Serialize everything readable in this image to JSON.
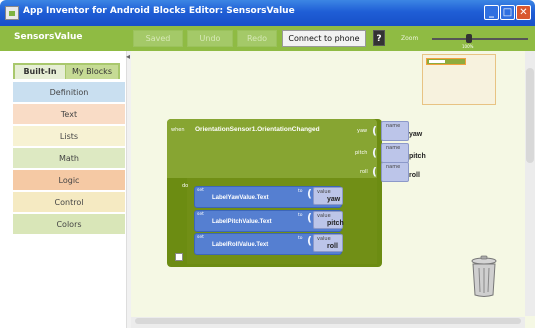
{
  "window": {
    "title": "App Inventor for Android Blocks Editor: SensorsValue",
    "min": "_",
    "max": "□",
    "close": "✕"
  },
  "toolbar": {
    "project_name": "SensorsValue",
    "saved": "Saved",
    "undo": "Undo",
    "redo": "Redo",
    "connect": "Connect to phone",
    "help": "?",
    "zoom_label": "Zoom",
    "zoom_value": "100%",
    "zoom_level_percent": 100
  },
  "sidebar": {
    "tabs": [
      {
        "label": "Built-In"
      },
      {
        "label": "My Blocks"
      }
    ],
    "drawers": [
      {
        "label": "Definition",
        "color": "#c9dff0"
      },
      {
        "label": "Text",
        "color": "#f9dcc6"
      },
      {
        "label": "Lists",
        "color": "#f7f2d3"
      },
      {
        "label": "Math",
        "color": "#dde9c2"
      },
      {
        "label": "Logic",
        "color": "#f5c9a4"
      },
      {
        "label": "Control",
        "color": "#f5eac2"
      },
      {
        "label": "Colors",
        "color": "#d9e6b8"
      }
    ]
  },
  "event_block": {
    "when": "when",
    "name": "OrientationSensor1.OrientationChanged",
    "params": [
      {
        "label": "yaw",
        "name_label": "name",
        "value": "yaw"
      },
      {
        "label": "pitch",
        "name_label": "name",
        "value": "pitch"
      },
      {
        "label": "roll",
        "name_label": "name",
        "value": "roll"
      }
    ],
    "do": "do",
    "statements": [
      {
        "set": "set",
        "property": "LabelYawValue.Text",
        "to": "to",
        "value_label": "value",
        "value": "yaw"
      },
      {
        "set": "set",
        "property": "LabelPitchValue.Text",
        "to": "to",
        "value_label": "value",
        "value": "pitch"
      },
      {
        "set": "set",
        "property": "LabelRollValue.Text",
        "to": "to",
        "value_label": "value",
        "value": "roll"
      }
    ]
  },
  "colors": {
    "toolbar": "#8fbb43",
    "event_block": "#87a532",
    "set_block": "#557fd1",
    "param_block": "#bcc5e9"
  }
}
